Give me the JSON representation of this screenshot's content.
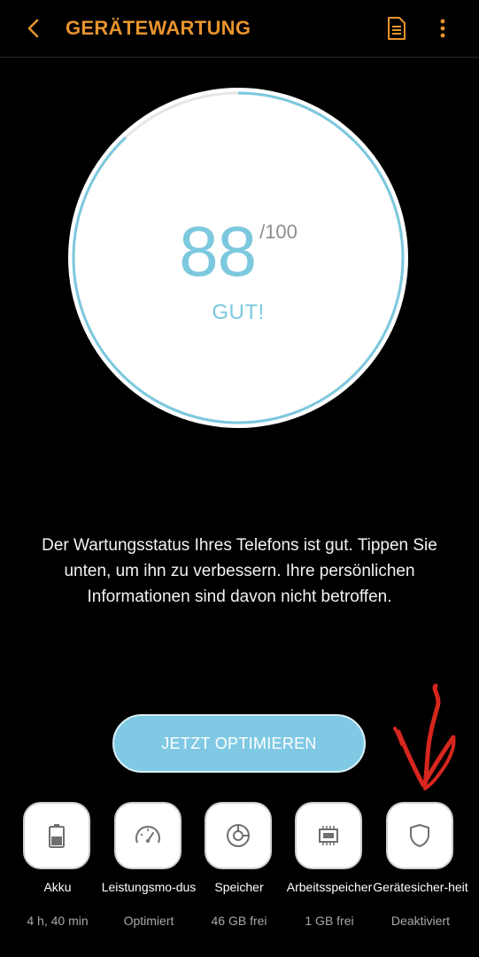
{
  "header": {
    "title": "GERÄTEWARTUNG",
    "back_icon": "chevron-left-icon",
    "report_icon": "document-icon",
    "more_icon": "more-vertical-icon",
    "accent_color": "#e8942e"
  },
  "score": {
    "value": "88",
    "max": "/100",
    "status": "GUT!",
    "progress": 0.88,
    "color": "#7cc8de"
  },
  "description": "Der Wartungsstatus Ihres Telefons ist gut. Tippen Sie unten, um ihn zu verbessern. Ihre persönlichen Informationen sind davon nicht betroffen.",
  "optimize_button": {
    "label": "JETZT OPTIMIEREN",
    "color": "#7fc9e4"
  },
  "tiles": [
    {
      "label": "Akku",
      "value": "4 h, 40 min",
      "icon": "battery-icon"
    },
    {
      "label": "Leistungsmo-dus",
      "value": "Optimiert",
      "icon": "speedometer-icon"
    },
    {
      "label": "Speicher",
      "value": "46 GB frei",
      "icon": "storage-icon"
    },
    {
      "label": "Arbeitsspeicher",
      "value": "1 GB frei",
      "icon": "chip-icon"
    },
    {
      "label": "Gerätesicher-heit",
      "value": "Deaktiviert",
      "icon": "shield-icon"
    }
  ],
  "annotation": {
    "icon": "red-arrow-annotation",
    "color": "#d7261e"
  }
}
